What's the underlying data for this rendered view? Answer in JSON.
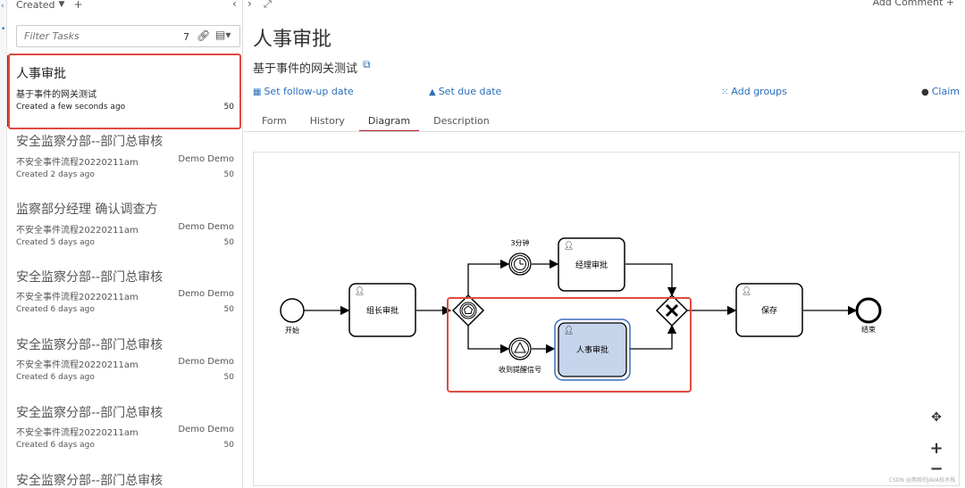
{
  "sidebar_filter": {
    "created_label": "Created",
    "placeholder": "Filter Tasks",
    "count": "7"
  },
  "tasks": [
    {
      "title": "人事审批",
      "process": "基于事件的网关测试",
      "assignee": "",
      "created": "Created a few seconds ago",
      "priority": "50"
    },
    {
      "title": "安全监察分部--部门总审核",
      "process": "不安全事件流程20220211am",
      "assignee": "Demo Demo",
      "created": "Created 2 days ago",
      "priority": "50"
    },
    {
      "title": "监察部分经理 确认调查方",
      "process": "不安全事件流程20220211am",
      "assignee": "Demo Demo",
      "created": "Created 5 days ago",
      "priority": "50"
    },
    {
      "title": "安全监察分部--部门总审核",
      "process": "不安全事件流程20220211am",
      "assignee": "Demo Demo",
      "created": "Created 6 days ago",
      "priority": "50"
    },
    {
      "title": "安全监察分部--部门总审核",
      "process": "不安全事件流程20220211am",
      "assignee": "Demo Demo",
      "created": "Created 6 days ago",
      "priority": "50"
    },
    {
      "title": "安全监察分部--部门总审核",
      "process": "不安全事件流程20220211am",
      "assignee": "Demo Demo",
      "created": "Created 6 days ago",
      "priority": "50"
    },
    {
      "title": "安全监察分部--部门总审核",
      "process": "",
      "assignee": "",
      "created": "",
      "priority": ""
    }
  ],
  "detail": {
    "add_comment": "Add Comment",
    "task_name": "人事审批",
    "process_name": "基于事件的网关测试",
    "actions": {
      "follow_up": "Set follow-up date",
      "due": "Set due date",
      "groups": "Add groups",
      "claim": "Claim"
    },
    "tabs": [
      "Form",
      "History",
      "Diagram",
      "Description"
    ],
    "active_tab": "Diagram"
  },
  "diagram": {
    "start": "开始",
    "task_leader": "组长审批",
    "timer_label": "3分钟",
    "task_manager": "经理审批",
    "signal_label": "收到提醒信号",
    "task_hr": "人事审批",
    "task_save": "保存",
    "end": "结束",
    "highlight_color": "#e04a3f",
    "active_task_color": "#c6d4ec"
  },
  "watermark": "CSDN @两周的JAVA技术栈",
  "colors": {
    "accent": "#b5152b",
    "link": "#2a6ebb"
  }
}
